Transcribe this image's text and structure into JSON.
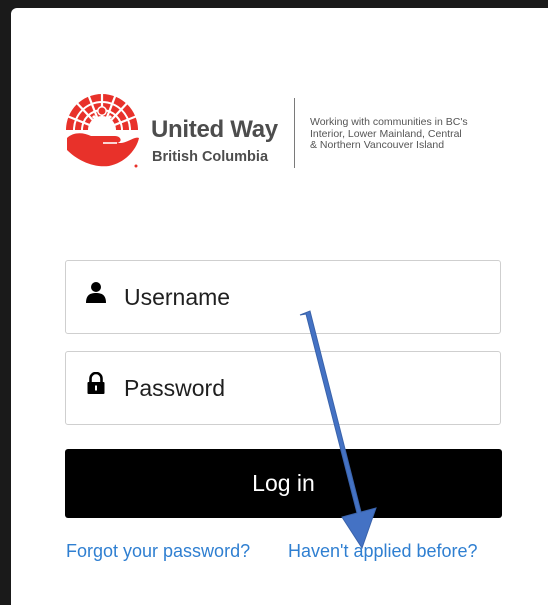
{
  "brand": {
    "name": "United Way",
    "subtitle": "British Columbia",
    "tagline": [
      "Working with communities in BC's",
      "Interior, Lower Mainland, Central",
      "& Northern Vancouver Island"
    ],
    "colors": {
      "logo_red": "#e8312a",
      "text_gray": "#4d4d4d"
    }
  },
  "form": {
    "username": {
      "placeholder": "Username",
      "value": "",
      "icon": "user-icon"
    },
    "password": {
      "placeholder": "Password",
      "value": "",
      "icon": "lock-icon"
    },
    "login_label": "Log in"
  },
  "links": {
    "forgot_password": "Forgot your password?",
    "not_applied": "Haven't applied before?"
  },
  "colors": {
    "link_blue": "#2f7fd1",
    "button_bg": "#000000",
    "annotation_arrow": "#4472c4"
  }
}
